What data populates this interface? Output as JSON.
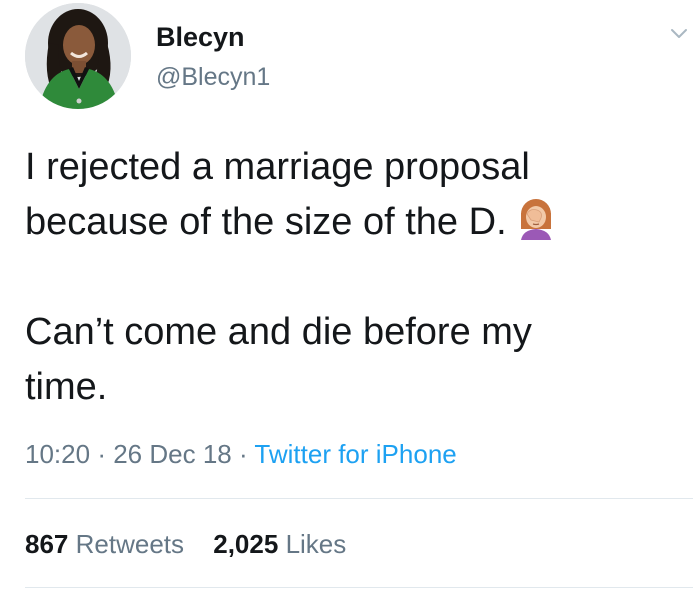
{
  "author": {
    "display_name": "Blecyn",
    "handle": "@Blecyn1"
  },
  "tweet": {
    "lines": [
      "I rejected a marriage proposal",
      "because of the size of the D.",
      "",
      "Can’t come and die before my",
      "time."
    ],
    "emoji": "face-palm-woman-icon"
  },
  "meta": {
    "time": "10:20",
    "sep1": "·",
    "date": "26 Dec 18",
    "sep2": "·",
    "source": "Twitter for iPhone"
  },
  "stats": {
    "retweets_count": "867",
    "retweets_label": "Retweets",
    "likes_count": "2,025",
    "likes_label": "Likes"
  },
  "colors": {
    "text": "#14171a",
    "secondary": "#657786",
    "link": "#1da1f2",
    "divider": "#e1e8ed"
  }
}
